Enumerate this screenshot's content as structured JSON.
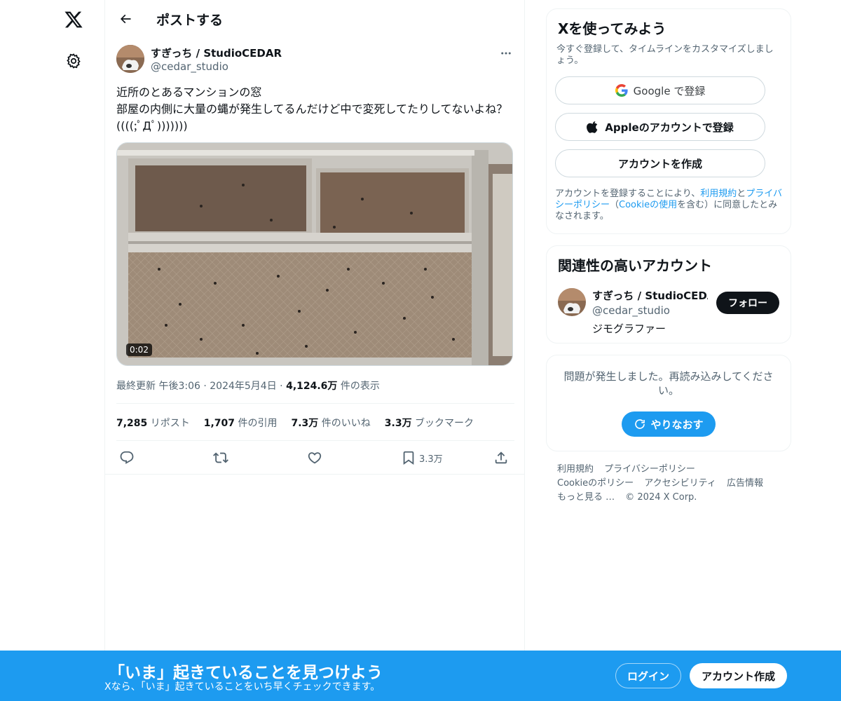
{
  "nav": {
    "logo_icon": "x-logo-icon",
    "settings_icon": "gear-icon"
  },
  "header": {
    "title": "ポストする"
  },
  "post": {
    "author_name": "すぎっち / StudioCEDAR",
    "author_handle": "@cedar_studio",
    "text": "近所のとあるマンションの窓\n部屋の内側に大量の蝿が発生してるんだけど中で変死してたりしてないよね？((((;ﾟДﾟ)))))))",
    "video_duration": "0:02",
    "updated_label": "最終更新",
    "time": "午後3:06",
    "date": "2024年5月4日",
    "views_value": "4,124.6万",
    "views_label": "件の表示",
    "separator": "·",
    "stats": {
      "reposts_value": "7,285",
      "reposts_label": "リポスト",
      "quotes_value": "1,707",
      "quotes_label": "件の引用",
      "likes_value": "7.3万",
      "likes_label": "件のいいね",
      "bookmarks_value": "3.3万",
      "bookmarks_label": "ブックマーク"
    },
    "bookmark_count": "3.3万"
  },
  "signup_card": {
    "title": "Xを使ってみよう",
    "subtitle": "今すぐ登録して、タイムラインをカスタマイズしましょう。",
    "google_label": "Google で登録",
    "apple_label": "Appleのアカウントで登録",
    "create_label": "アカウントを作成",
    "terms_prefix": "アカウントを登録することにより、",
    "terms_link": "利用規約",
    "terms_and": "と",
    "privacy_link": "プライバシーポリシー",
    "terms_mid": "（",
    "cookie_link": "Cookieの使用",
    "terms_suffix": "を含む）に同意したとみなされます。"
  },
  "related_card": {
    "title": "関連性の高いアカウント",
    "name": "すぎっち / StudioCEDAR",
    "handle": "@cedar_studio",
    "bio": "ジモグラファー",
    "follow_label": "フォロー"
  },
  "error_card": {
    "message": "問題が発生しました。再読み込みしてください。",
    "retry_label": "やりなおす"
  },
  "footer": {
    "terms": "利用規約",
    "privacy": "プライバシーポリシー",
    "cookie": "Cookieのポリシー",
    "accessibility": "アクセシビリティ",
    "ads": "広告情報",
    "more": "もっと見る …",
    "copyright": "© 2024 X Corp."
  },
  "bottom_bar": {
    "title": "「いま」起きていることを見つけよう",
    "subtitle": "Xなら、「いま」起きていることをいち早くチェックできます。",
    "login_label": "ログイン",
    "signup_label": "アカウント作成"
  },
  "colors": {
    "accent": "#1d9bf0",
    "text": "#0f1419",
    "muted": "#536471",
    "border": "#eff3f4"
  }
}
